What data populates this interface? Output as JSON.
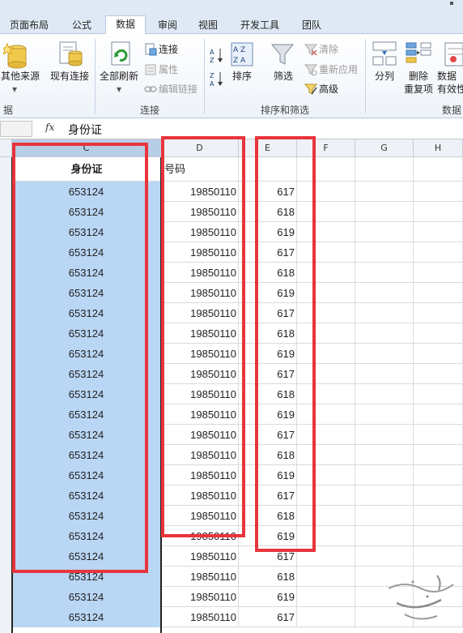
{
  "ribbon": {
    "tabs": [
      "页面布局",
      "公式",
      "数据",
      "审阅",
      "视图",
      "开发工具",
      "团队"
    ],
    "active_tab": "数据",
    "buttons": {
      "other_source": "其他来源",
      "existing_conn": "现有连接",
      "refresh_all": "全部刷新",
      "connections": "连接",
      "properties": "属性",
      "edit_links": "编辑链接",
      "sort": "排序",
      "filter": "筛选",
      "clear": "清除",
      "reapply": "重新应用",
      "advanced": "高级",
      "text_to_columns": "分列",
      "remove_dup_line1": "删除",
      "remove_dup_line2": "重复项",
      "validation_line1": "数据",
      "validation_line2": "有效性"
    },
    "groups": {
      "external_partial": "据",
      "connections": "连接",
      "sort_filter": "排序和筛选",
      "data_tools_partial": "数据"
    }
  },
  "formula_bar": {
    "fx_label": "fx",
    "content": "身份证"
  },
  "sheet": {
    "columns": [
      "C",
      "D",
      "E",
      "F",
      "G",
      "H"
    ],
    "selected_column": "C",
    "col_c_header": "身份证",
    "col_d_header_partial": "号码",
    "rows": [
      {
        "c": "653124",
        "d": "19850110",
        "e": "617"
      },
      {
        "c": "653124",
        "d": "19850110",
        "e": "618"
      },
      {
        "c": "653124",
        "d": "19850110",
        "e": "619"
      },
      {
        "c": "653124",
        "d": "19850110",
        "e": "617"
      },
      {
        "c": "653124",
        "d": "19850110",
        "e": "618"
      },
      {
        "c": "653124",
        "d": "19850110",
        "e": "619"
      },
      {
        "c": "653124",
        "d": "19850110",
        "e": "617"
      },
      {
        "c": "653124",
        "d": "19850110",
        "e": "618"
      },
      {
        "c": "653124",
        "d": "19850110",
        "e": "619"
      },
      {
        "c": "653124",
        "d": "19850110",
        "e": "617"
      },
      {
        "c": "653124",
        "d": "19850110",
        "e": "618"
      },
      {
        "c": "653124",
        "d": "19850110",
        "e": "619"
      },
      {
        "c": "653124",
        "d": "19850110",
        "e": "617"
      },
      {
        "c": "653124",
        "d": "19850110",
        "e": "618"
      },
      {
        "c": "653124",
        "d": "19850110",
        "e": "619"
      },
      {
        "c": "653124",
        "d": "19850110",
        "e": "617"
      },
      {
        "c": "653124",
        "d": "19850110",
        "e": "618"
      },
      {
        "c": "653124",
        "d": "19850110",
        "e": "619"
      },
      {
        "c": "653124",
        "d": "19850110",
        "e": "617"
      },
      {
        "c": "653124",
        "d": "19850110",
        "e": "618"
      },
      {
        "c": "653124",
        "d": "19850110",
        "e": "619"
      },
      {
        "c": "653124",
        "d": "19850110",
        "e": "617"
      }
    ]
  },
  "colors": {
    "selection": "#b9d6f4",
    "highlight_box": "#e8343c",
    "ribbon_bg": "#dfe9f5"
  }
}
